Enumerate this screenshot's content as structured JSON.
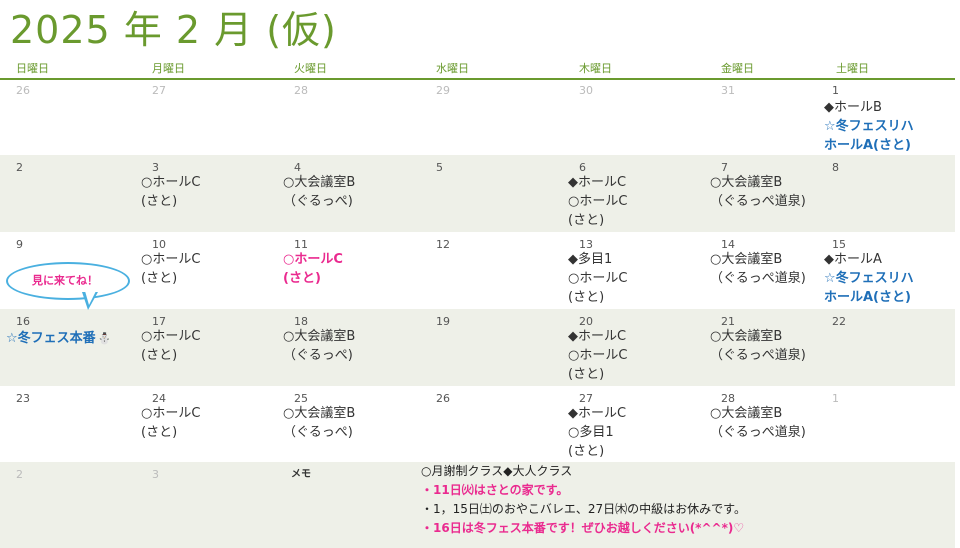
{
  "title": "2025 年 2 月 (仮)",
  "weekdays": [
    "日曜日",
    "月曜日",
    "火曜日",
    "水曜日",
    "木曜日",
    "金曜日",
    "土曜日"
  ],
  "weeks": [
    {
      "shaded": false,
      "days": [
        {
          "num": "26",
          "muted": true,
          "events": []
        },
        {
          "num": "27",
          "muted": true,
          "events": []
        },
        {
          "num": "28",
          "muted": true,
          "events": []
        },
        {
          "num": "29",
          "muted": true,
          "events": []
        },
        {
          "num": "30",
          "muted": true,
          "events": []
        },
        {
          "num": "31",
          "muted": true,
          "events": []
        },
        {
          "num": "1",
          "muted": false,
          "events": [
            {
              "text": "◆ホールB",
              "style": ""
            },
            {
              "text": "☆冬フェスリハ",
              "style": "blue"
            },
            {
              "text": "ホールA(さと)",
              "style": "blue"
            }
          ]
        }
      ]
    },
    {
      "shaded": true,
      "days": [
        {
          "num": "2",
          "muted": false,
          "events": []
        },
        {
          "num": "3",
          "muted": false,
          "events": [
            {
              "text": "○ホールC",
              "style": ""
            },
            {
              "text": "(さと)",
              "style": ""
            }
          ]
        },
        {
          "num": "4",
          "muted": false,
          "events": [
            {
              "text": "○大会議室B",
              "style": ""
            },
            {
              "text": "（ぐるっぺ)",
              "style": ""
            }
          ]
        },
        {
          "num": "5",
          "muted": false,
          "events": []
        },
        {
          "num": "6",
          "muted": false,
          "events": [
            {
              "text": "◆ホールC",
              "style": ""
            },
            {
              "text": "○ホールC",
              "style": ""
            },
            {
              "text": "(さと)",
              "style": ""
            }
          ]
        },
        {
          "num": "7",
          "muted": false,
          "events": [
            {
              "text": "○大会議室B",
              "style": ""
            },
            {
              "text": "（ぐるっぺ道泉)",
              "style": ""
            }
          ]
        },
        {
          "num": "8",
          "muted": false,
          "events": []
        }
      ]
    },
    {
      "shaded": false,
      "days": [
        {
          "num": "9",
          "muted": false,
          "events": []
        },
        {
          "num": "10",
          "muted": false,
          "events": [
            {
              "text": "○ホールC",
              "style": ""
            },
            {
              "text": "(さと)",
              "style": ""
            }
          ]
        },
        {
          "num": "11",
          "muted": false,
          "events": [
            {
              "text": "○ホールC",
              "style": "pink"
            },
            {
              "text": "(さと)",
              "style": "pink"
            }
          ]
        },
        {
          "num": "12",
          "muted": false,
          "events": []
        },
        {
          "num": "13",
          "muted": false,
          "events": [
            {
              "text": "◆多目1",
              "style": ""
            },
            {
              "text": "○ホールC",
              "style": ""
            },
            {
              "text": "(さと)",
              "style": ""
            }
          ]
        },
        {
          "num": "14",
          "muted": false,
          "events": [
            {
              "text": "○大会議室B",
              "style": ""
            },
            {
              "text": "（ぐるっぺ道泉)",
              "style": ""
            }
          ]
        },
        {
          "num": "15",
          "muted": false,
          "events": [
            {
              "text": "◆ホールA",
              "style": ""
            },
            {
              "text": "☆冬フェスリハ",
              "style": "blue"
            },
            {
              "text": "ホールA(さと)",
              "style": "blue"
            }
          ]
        }
      ]
    },
    {
      "shaded": true,
      "days": [
        {
          "num": "16",
          "muted": false,
          "events": [
            {
              "text": "☆冬フェス本番",
              "style": "blue",
              "icon": "⛄"
            }
          ]
        },
        {
          "num": "17",
          "muted": false,
          "events": [
            {
              "text": "○ホールC",
              "style": ""
            },
            {
              "text": "(さと)",
              "style": ""
            }
          ]
        },
        {
          "num": "18",
          "muted": false,
          "events": [
            {
              "text": "○大会議室B",
              "style": ""
            },
            {
              "text": "（ぐるっぺ)",
              "style": ""
            }
          ]
        },
        {
          "num": "19",
          "muted": false,
          "events": []
        },
        {
          "num": "20",
          "muted": false,
          "events": [
            {
              "text": "◆ホールC",
              "style": ""
            },
            {
              "text": "○ホールC",
              "style": ""
            },
            {
              "text": "(さと)",
              "style": ""
            }
          ]
        },
        {
          "num": "21",
          "muted": false,
          "events": [
            {
              "text": "○大会議室B",
              "style": ""
            },
            {
              "text": "（ぐるっぺ道泉)",
              "style": ""
            }
          ]
        },
        {
          "num": "22",
          "muted": false,
          "events": []
        }
      ]
    },
    {
      "shaded": false,
      "days": [
        {
          "num": "23",
          "muted": false,
          "events": []
        },
        {
          "num": "24",
          "muted": false,
          "events": [
            {
              "text": "○ホールC",
              "style": ""
            },
            {
              "text": " (さと)",
              "style": ""
            }
          ]
        },
        {
          "num": "25",
          "muted": false,
          "events": [
            {
              "text": "○大会議室B",
              "style": ""
            },
            {
              "text": "（ぐるっぺ)",
              "style": ""
            }
          ]
        },
        {
          "num": "26",
          "muted": false,
          "events": []
        },
        {
          "num": "27",
          "muted": false,
          "events": [
            {
              "text": "◆ホールC",
              "style": ""
            },
            {
              "text": "○多目1",
              "style": ""
            },
            {
              "text": "(さと)",
              "style": ""
            }
          ]
        },
        {
          "num": "28",
          "muted": false,
          "events": [
            {
              "text": "○大会議室B",
              "style": ""
            },
            {
              "text": "（ぐるっぺ道泉)",
              "style": ""
            }
          ]
        },
        {
          "num": "1",
          "muted": true,
          "events": []
        }
      ]
    },
    {
      "shaded": true,
      "days": [
        {
          "num": "2",
          "muted": true,
          "events": []
        },
        {
          "num": "3",
          "muted": true,
          "events": []
        }
      ]
    }
  ],
  "bubble_text": "見に来てね！",
  "memo_label": "メモ",
  "memo_lines": [
    {
      "text": "○月謝制クラス◆大人クラス",
      "style": ""
    },
    {
      "text": "・11日㈫はさとの家です。",
      "style": "pink"
    },
    {
      "text": "・1，15日㈯のおやこバレエ、27日㈭の中級はお休みです。",
      "style": ""
    },
    {
      "text": "・16日は冬フェス本番です！ぜひお越しください(*^^*)♡",
      "style": "pink"
    }
  ],
  "colors": {
    "accent": "#6a9a2e",
    "pink": "#ea2a8f",
    "blue": "#1f6fb8",
    "shade": "#eef0e8"
  }
}
